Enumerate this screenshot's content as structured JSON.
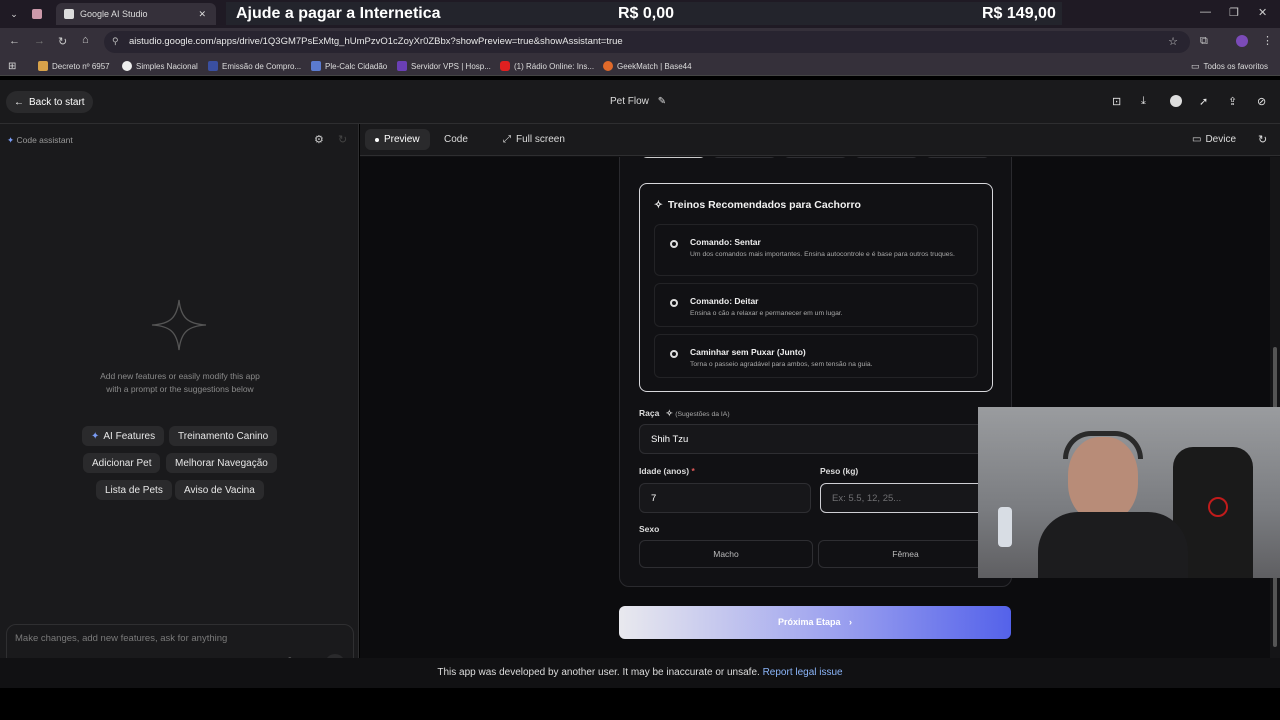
{
  "browser": {
    "tab_title": "Google AI Studio",
    "banner": {
      "text": "Ajude a pagar a Internetica",
      "amount_current": "R$ 0,00",
      "amount_goal": "R$ 149,00"
    },
    "url": "aistudio.google.com/apps/drive/1Q3GM7PsExMtg_hUmPzvO1cZoyXr0ZBbx?showPreview=true&showAssistant=true",
    "bookmarks": [
      "Decreto nº 6957",
      "Simples Nacional",
      "Emissão de Compro...",
      "Ple-Calc Cidadão",
      "Servidor VPS | Hosp...",
      "(1) Rádio Online: Ins...",
      "GeekMatch | Base44"
    ],
    "bookmarks_folder": "Todos os favoritos"
  },
  "app": {
    "back_label": "Back to start",
    "title": "Pet Flow"
  },
  "assistant": {
    "label": "Code assistant",
    "hint": "Add new features or easily modify this app with a prompt or the suggestions below",
    "chips": [
      "AI Features",
      "Treinamento Canino",
      "Adicionar Pet",
      "Melhorar Navegação",
      "Lista de Pets",
      "Aviso de Vacina"
    ],
    "prompt_placeholder": "Make changes, add new features, ask for anything"
  },
  "toolbar": {
    "preview": "Preview",
    "code": "Code",
    "fullscreen": "Full screen",
    "device": "Device"
  },
  "form": {
    "treinos_title": "Treinos Recomendados para Cachorro",
    "treinos": [
      {
        "title": "Comando: Sentar",
        "desc": "Um dos comandos mais importantes. Ensina autocontrole e é base para outros truques."
      },
      {
        "title": "Comando: Deitar",
        "desc": "Ensina o cão a relaxar e permanecer em um lugar."
      },
      {
        "title": "Caminhar sem Puxar (Junto)",
        "desc": "Torna o passeio agradável para ambos, sem tensão na guia."
      }
    ],
    "raca_label": "Raça",
    "raca_hint": "(Sugestões da IA)",
    "raca_value": "Shih Tzu",
    "idade_label": "Idade (anos)",
    "idade_required": "*",
    "idade_value": "7",
    "peso_label": "Peso (kg)",
    "peso_placeholder": "Ex: 5.5, 12, 25...",
    "sexo_label": "Sexo",
    "sexo_options": [
      "Macho",
      "Fêmea"
    ],
    "next_label": "Próxima Etapa"
  },
  "footer": {
    "text": "This app was developed by another user. It may be inaccurate or unsafe.",
    "link": "Report legal issue"
  },
  "colors": {
    "accent": "#5462ea",
    "link": "#8ab4f8",
    "required": "#e05a5a"
  }
}
